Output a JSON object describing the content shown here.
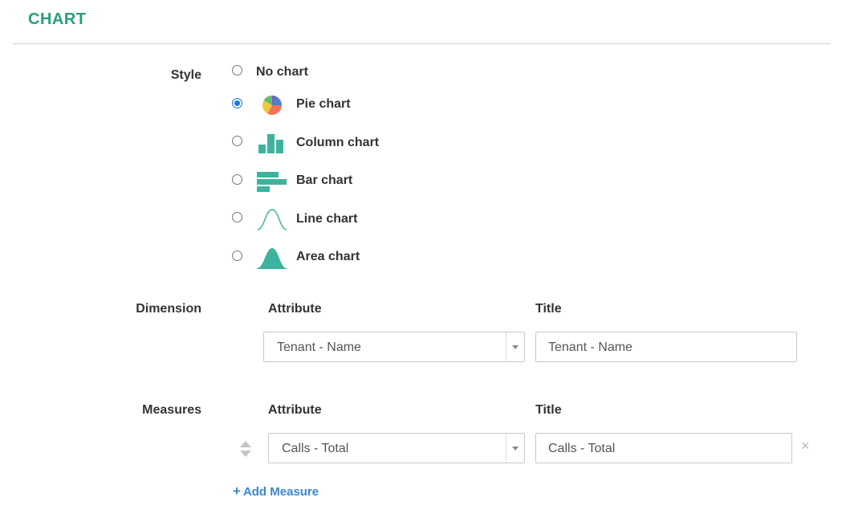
{
  "section": {
    "title": "CHART"
  },
  "style": {
    "label": "Style",
    "options": [
      {
        "label": "No chart",
        "icon": "",
        "checked": false
      },
      {
        "label": "Pie chart",
        "icon": "pie-chart-icon",
        "checked": true
      },
      {
        "label": "Column chart",
        "icon": "column-chart-icon",
        "checked": false
      },
      {
        "label": "Bar chart",
        "icon": "bar-chart-icon",
        "checked": false
      },
      {
        "label": "Line chart",
        "icon": "line-chart-icon",
        "checked": false
      },
      {
        "label": "Area chart",
        "icon": "area-chart-icon",
        "checked": false
      }
    ]
  },
  "dimension": {
    "label": "Dimension",
    "attribute_header": "Attribute",
    "title_header": "Title",
    "attribute_value": "Tenant - Name",
    "title_value": "Tenant - Name"
  },
  "measures": {
    "label": "Measures",
    "attribute_header": "Attribute",
    "title_header": "Title",
    "items": [
      {
        "attribute_value": "Calls - Total",
        "title_value": "Calls - Total",
        "remove": "×"
      }
    ],
    "add_label": "Add Measure",
    "add_icon": "+"
  },
  "colors": {
    "accent": "#24a07a",
    "link": "#3a87c9",
    "icon_teal": "#3db39e",
    "radio": "#1a73e8"
  }
}
